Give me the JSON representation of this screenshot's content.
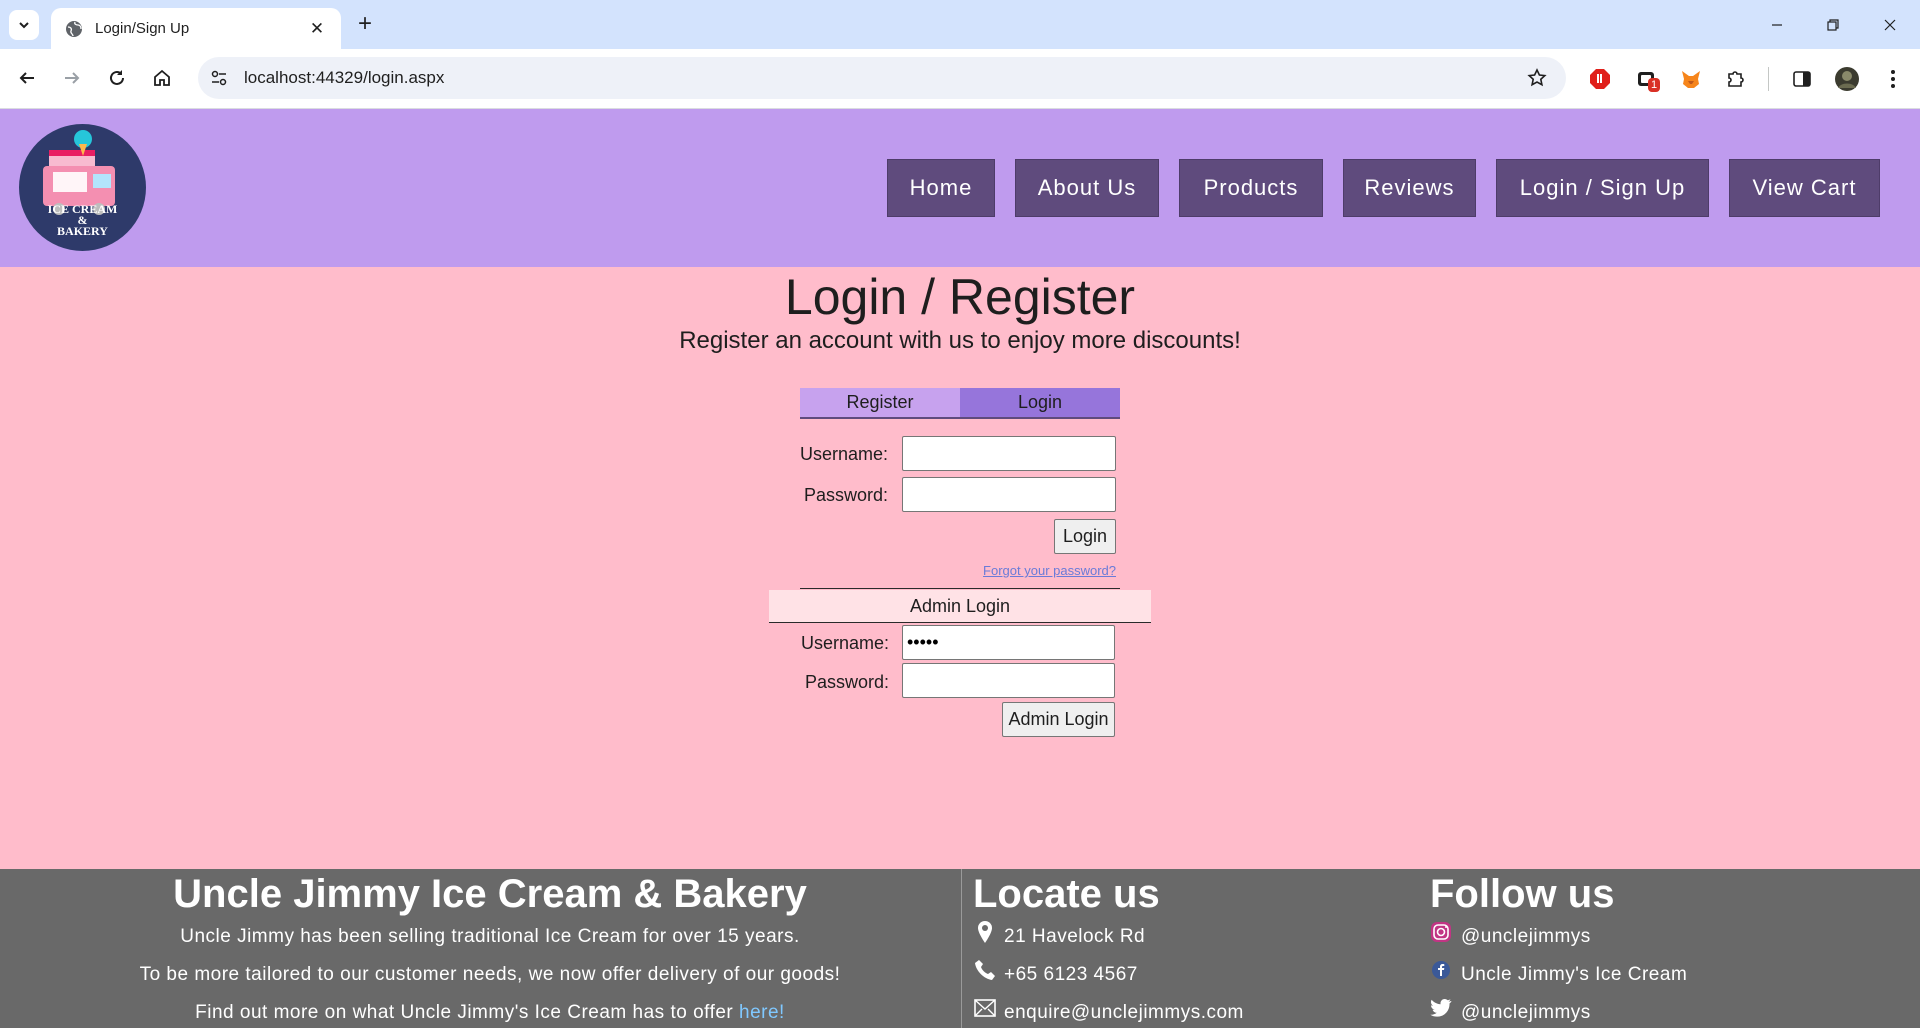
{
  "browser": {
    "tab_title": "Login/Sign Up",
    "url": "localhost:44329/login.aspx",
    "extension_badge": "1"
  },
  "header": {
    "logo_text_line1": "ICE CREAM",
    "logo_text_line2": "&",
    "logo_text_line3": "BAKERY",
    "nav": [
      "Home",
      "About Us",
      "Products",
      "Reviews",
      "Login / Sign Up",
      "View Cart"
    ]
  },
  "main": {
    "title": "Login / Register",
    "subtitle": "Register an account with us to enjoy more discounts!",
    "tabs": {
      "register": "Register",
      "login": "Login"
    },
    "login_form": {
      "username_label": "Username:",
      "password_label": "Password:",
      "username_value": "",
      "password_value": "",
      "login_button": "Login",
      "forgot_link": "Forgot your password?"
    },
    "admin_form": {
      "heading": "Admin Login",
      "username_label": "Username:",
      "password_label": "Password:",
      "username_value": "•••••",
      "password_value": "",
      "login_button": "Admin Login"
    }
  },
  "footer": {
    "about": {
      "title": "Uncle Jimmy Ice Cream & Bakery",
      "line1": "Uncle Jimmy has been selling traditional Ice Cream for over 15 years.",
      "line2": "To be more tailored to our customer needs, we now offer delivery of our goods!",
      "line3": "Find out more on what Uncle Jimmy's Ice Cream has to offer",
      "line3_link": "here!"
    },
    "locate": {
      "title": "Locate us",
      "address": "21 Havelock Rd",
      "phone": "+65 6123 4567",
      "email": "enquire@unclejimmys.com"
    },
    "follow": {
      "title": "Follow us",
      "instagram": "@unclejimmys",
      "facebook": "Uncle Jimmy's Ice Cream",
      "twitter": "@unclejimmys"
    }
  }
}
